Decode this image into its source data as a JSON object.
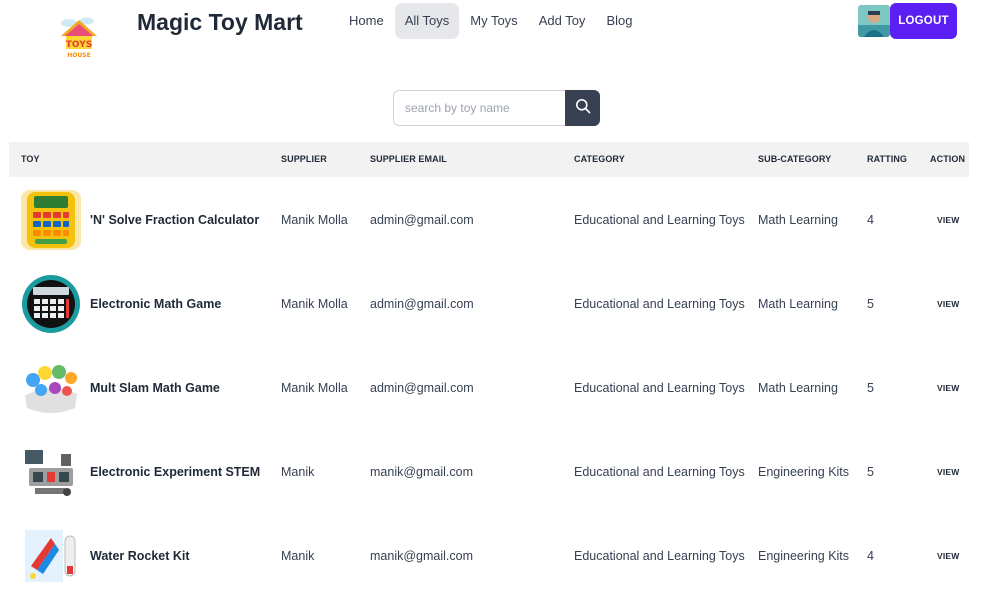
{
  "header": {
    "brand": "Magic Toy Mart",
    "logo_alt": "Toys House",
    "nav": [
      {
        "label": "Home",
        "active": false
      },
      {
        "label": "All Toys",
        "active": true
      },
      {
        "label": "My Toys",
        "active": false
      },
      {
        "label": "Add Toy",
        "active": false
      },
      {
        "label": "Blog",
        "active": false
      }
    ],
    "logout_label": "LOGOUT",
    "accent_color": "#5b1ff2"
  },
  "search": {
    "placeholder": "search by toy name",
    "value": "",
    "icon": "search-icon"
  },
  "table": {
    "columns": [
      "TOY",
      "SUPPLIER",
      "SUPPLIER EMAIL",
      "CATEGORY",
      "SUB-CATEGORY",
      "RATTING",
      "ACTION"
    ],
    "rows": [
      {
        "name": "'N' Solve Fraction Calculator",
        "supplier": "Manik Molla",
        "email": "admin@gmail.com",
        "category": "Educational and Learning Toys",
        "sub_category": "Math Learning",
        "rating": "4",
        "action": "VIEW",
        "thumb": "calculator-toy-image"
      },
      {
        "name": "Electronic Math Game",
        "supplier": "Manik Molla",
        "email": "admin@gmail.com",
        "category": "Educational and Learning Toys",
        "sub_category": "Math Learning",
        "rating": "5",
        "action": "VIEW",
        "thumb": "math-game-image"
      },
      {
        "name": "Mult Slam Math Game",
        "supplier": "Manik Molla",
        "email": "admin@gmail.com",
        "category": "Educational and Learning Toys",
        "sub_category": "Math Learning",
        "rating": "5",
        "action": "VIEW",
        "thumb": "mult-slam-image"
      },
      {
        "name": "Electronic Experiment STEM",
        "supplier": "Manik",
        "email": "manik@gmail.com",
        "category": "Educational and Learning Toys",
        "sub_category": "Engineering Kits",
        "rating": "5",
        "action": "VIEW",
        "thumb": "stem-kit-image"
      },
      {
        "name": "Water Rocket Kit",
        "supplier": "Manik",
        "email": "manik@gmail.com",
        "category": "Educational and Learning Toys",
        "sub_category": "Engineering Kits",
        "rating": "4",
        "action": "VIEW",
        "thumb": "rocket-kit-image"
      }
    ]
  }
}
